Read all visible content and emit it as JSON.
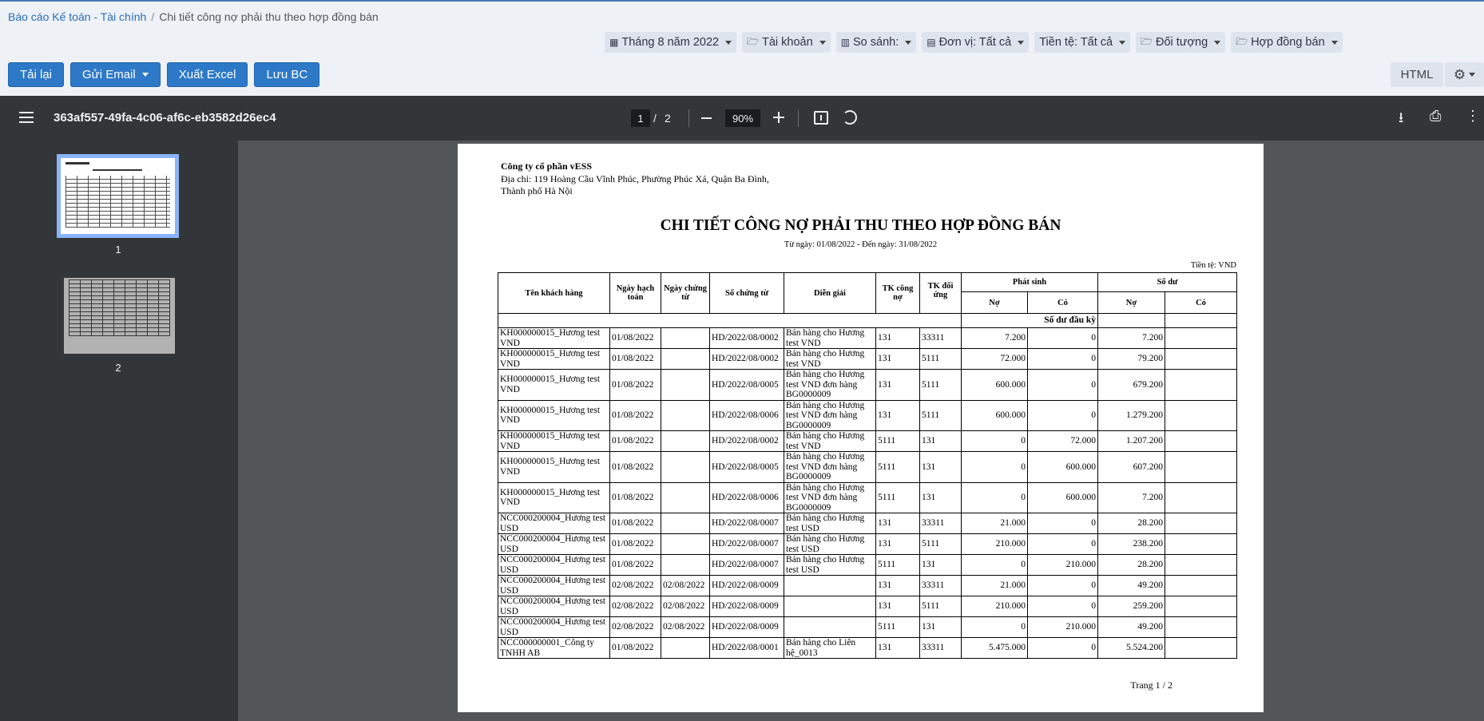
{
  "breadcrumb": {
    "parent": "Báo cáo Kế toán - Tài chính",
    "separator": "/",
    "current": "Chi tiết công nợ phải thu theo hợp đồng bán"
  },
  "filters": [
    {
      "icon": "calendar-icon",
      "glyph": "▦",
      "label": "Tháng 8 năm 2022"
    },
    {
      "icon": "folder-open-icon",
      "glyph": "🗁",
      "label": "Tài khoản"
    },
    {
      "icon": "bar-chart-icon",
      "glyph": "▥",
      "label": "So sánh:"
    },
    {
      "icon": "building-icon",
      "glyph": "▤",
      "label": "Đơn vị: Tất cả"
    },
    {
      "icon": "",
      "glyph": "",
      "label": "Tiền tệ: Tất cả"
    },
    {
      "icon": "folder-open-icon",
      "glyph": "🗁",
      "label": "Đối tượng"
    },
    {
      "icon": "folder-open-icon",
      "glyph": "🗁",
      "label": "Hợp đồng bán"
    }
  ],
  "toolbar": {
    "reload": "Tải lại",
    "send_email": "Gửi Email",
    "export_excel": "Xuất Excel",
    "save_report": "Lưu BC",
    "html": "HTML",
    "settings_icon": "gear-icon"
  },
  "viewer": {
    "filename": "363af557-49fa-4c06-af6c-eb3582d26ec4",
    "page_current": "1",
    "page_separator": "/",
    "page_total": "2",
    "zoom": "90%",
    "thumbnails": [
      "1",
      "2"
    ]
  },
  "report": {
    "company": "Công ty cổ phần vESS",
    "address": "Địa chỉ: 119 Hoàng Cầu Vĩnh Phúc, Phường Phúc Xá, Quận Ba Đình, Thành phố Hà Nội",
    "title": "CHI TIẾT CÔNG NỢ PHẢI THU THEO HỢP ĐỒNG BÁN",
    "period": "Từ ngày: 01/08/2022 - Đến ngày: 31/08/2022",
    "currency": "Tiền tệ: VND",
    "page_footer": "Trang 1 /  2",
    "headers": {
      "customer": "Tên khách hàng",
      "posting_date": "Ngày hạch toán",
      "doc_date": "Ngày chứng từ",
      "doc_no": "Số chứng từ",
      "description": "Diễn giải",
      "account": "TK công nợ",
      "counter_account": "TK đối ứng",
      "arising": "Phát sinh",
      "balance": "Số dư",
      "debit": "Nợ",
      "credit": "Có",
      "debit2": "Nợ",
      "credit2": "Có"
    },
    "opening_label": "Số dư đầu kỳ",
    "rows": [
      [
        "KH000000015_Hương test VND",
        "01/08/2022",
        "",
        "HD/2022/08/0002",
        "Bán hàng cho Hương test VND",
        "131",
        "33311",
        "7.200",
        "0",
        "7.200",
        ""
      ],
      [
        "KH000000015_Hương test VND",
        "01/08/2022",
        "",
        "HD/2022/08/0002",
        "Bán hàng cho Hương test VND",
        "131",
        "5111",
        "72.000",
        "0",
        "79.200",
        ""
      ],
      [
        "KH000000015_Hương test VND",
        "01/08/2022",
        "",
        "HD/2022/08/0005",
        "Bán hàng cho Hương test VND đơn hàng BG0000009",
        "131",
        "5111",
        "600.000",
        "0",
        "679.200",
        ""
      ],
      [
        "KH000000015_Hương test VND",
        "01/08/2022",
        "",
        "HD/2022/08/0006",
        "Bán hàng cho Hương test VND đơn hàng BG0000009",
        "131",
        "5111",
        "600.000",
        "0",
        "1.279.200",
        ""
      ],
      [
        "KH000000015_Hương test VND",
        "01/08/2022",
        "",
        "HD/2022/08/0002",
        "Bán hàng cho Hương test VND",
        "5111",
        "131",
        "0",
        "72.000",
        "1.207.200",
        ""
      ],
      [
        "KH000000015_Hương test VND",
        "01/08/2022",
        "",
        "HD/2022/08/0005",
        "Bán hàng cho Hương test VND đơn hàng BG0000009",
        "5111",
        "131",
        "0",
        "600.000",
        "607.200",
        ""
      ],
      [
        "KH000000015_Hương test VND",
        "01/08/2022",
        "",
        "HD/2022/08/0006",
        "Bán hàng cho Hương test VND đơn hàng BG0000009",
        "5111",
        "131",
        "0",
        "600.000",
        "7.200",
        ""
      ],
      [
        "NCC000200004_Hương test USD",
        "01/08/2022",
        "",
        "HD/2022/08/0007",
        "Bán hàng cho Hương test USD",
        "131",
        "33311",
        "21.000",
        "0",
        "28.200",
        ""
      ],
      [
        "NCC000200004_Hương test USD",
        "01/08/2022",
        "",
        "HD/2022/08/0007",
        "Bán hàng cho Hương test USD",
        "131",
        "5111",
        "210.000",
        "0",
        "238.200",
        ""
      ],
      [
        "NCC000200004_Hương test USD",
        "01/08/2022",
        "",
        "HD/2022/08/0007",
        "Bán hàng cho Hương test USD",
        "5111",
        "131",
        "0",
        "210.000",
        "28.200",
        ""
      ],
      [
        "NCC000200004_Hương test USD",
        "02/08/2022",
        "02/08/2022",
        "HD/2022/08/0009",
        "",
        "131",
        "33311",
        "21.000",
        "0",
        "49.200",
        ""
      ],
      [
        "NCC000200004_Hương test USD",
        "02/08/2022",
        "02/08/2022",
        "HD/2022/08/0009",
        "",
        "131",
        "5111",
        "210.000",
        "0",
        "259.200",
        ""
      ],
      [
        "NCC000200004_Hương test USD",
        "02/08/2022",
        "02/08/2022",
        "HD/2022/08/0009",
        "",
        "5111",
        "131",
        "0",
        "210.000",
        "49.200",
        ""
      ],
      [
        "NCC000000001_Công ty TNHH AB",
        "01/08/2022",
        "",
        "HD/2022/08/0001",
        "Bán hàng cho Liên hệ_0013",
        "131",
        "33311",
        "5.475.000",
        "0",
        "5.524.200",
        ""
      ]
    ]
  }
}
